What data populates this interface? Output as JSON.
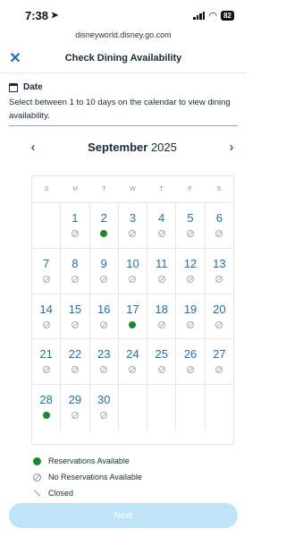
{
  "status_bar": {
    "time": "7:38",
    "battery": "82"
  },
  "browser": {
    "url": "disneyworld.disney.go.com"
  },
  "header": {
    "title": "Check Dining Availability",
    "close_icon": "close-icon"
  },
  "date_section": {
    "label": "Date",
    "instructions": "Select between 1 to 10 days on the calendar to view dining availability."
  },
  "calendar": {
    "month": "September",
    "year": "2025",
    "weekdays": [
      "S",
      "M",
      "T",
      "W",
      "T",
      "F",
      "S"
    ],
    "weeks": [
      [
        null,
        {
          "day": "1",
          "status": "none"
        },
        {
          "day": "2",
          "status": "available"
        },
        {
          "day": "3",
          "status": "none"
        },
        {
          "day": "4",
          "status": "none"
        },
        {
          "day": "5",
          "status": "none"
        },
        {
          "day": "6",
          "status": "none"
        }
      ],
      [
        {
          "day": "7",
          "status": "none"
        },
        {
          "day": "8",
          "status": "none"
        },
        {
          "day": "9",
          "status": "none"
        },
        {
          "day": "10",
          "status": "none"
        },
        {
          "day": "11",
          "status": "none"
        },
        {
          "day": "12",
          "status": "none"
        },
        {
          "day": "13",
          "status": "none"
        }
      ],
      [
        {
          "day": "14",
          "status": "none"
        },
        {
          "day": "15",
          "status": "none"
        },
        {
          "day": "16",
          "status": "none"
        },
        {
          "day": "17",
          "status": "available"
        },
        {
          "day": "18",
          "status": "none"
        },
        {
          "day": "19",
          "status": "none"
        },
        {
          "day": "20",
          "status": "none"
        }
      ],
      [
        {
          "day": "21",
          "status": "none"
        },
        {
          "day": "22",
          "status": "none"
        },
        {
          "day": "23",
          "status": "none"
        },
        {
          "day": "24",
          "status": "none"
        },
        {
          "day": "25",
          "status": "none"
        },
        {
          "day": "26",
          "status": "none"
        },
        {
          "day": "27",
          "status": "none"
        }
      ],
      [
        {
          "day": "28",
          "status": "available"
        },
        {
          "day": "29",
          "status": "none"
        },
        {
          "day": "30",
          "status": "none"
        },
        null,
        null,
        null,
        null
      ]
    ]
  },
  "legend": {
    "available": "Reservations Available",
    "none": "No Reservations Available",
    "closed": "Closed"
  },
  "actions": {
    "next_label": "Next"
  },
  "colors": {
    "accent": "#1f6fb5",
    "available": "#1a8a2e",
    "next_disabled": "#bfe3f7"
  }
}
